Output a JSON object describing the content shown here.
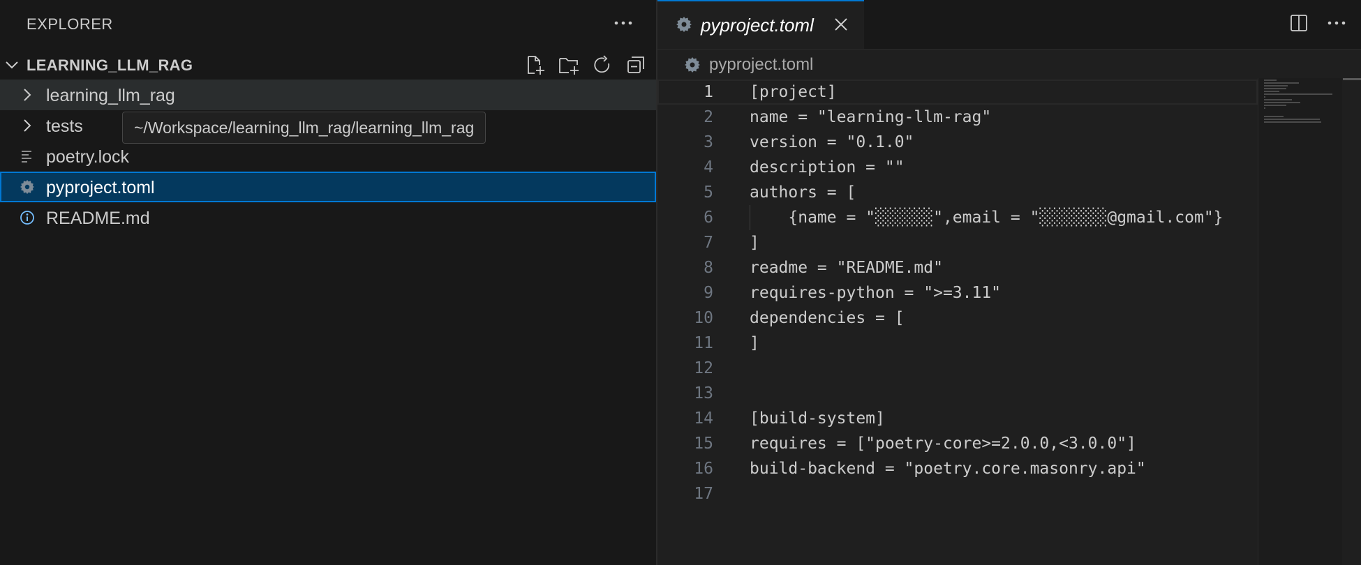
{
  "explorer": {
    "title": "EXPLORER",
    "more_icon": "ellipsis-icon",
    "folder_name": "LEARNING_LLM_RAG",
    "folder_actions": [
      "new-file-icon",
      "new-folder-icon",
      "refresh-icon",
      "collapse-all-icon"
    ],
    "items": [
      {
        "label": "learning_llm_rag",
        "icon": "chevron-right-icon",
        "state": "hover"
      },
      {
        "label": "tests",
        "icon": "chevron-right-icon",
        "state": ""
      },
      {
        "label": "poetry.lock",
        "icon": "lines-file-icon",
        "state": ""
      },
      {
        "label": "pyproject.toml",
        "icon": "gear-icon",
        "state": "selected"
      },
      {
        "label": "README.md",
        "icon": "info-icon",
        "state": ""
      }
    ],
    "tooltip": "~/Workspace/learning_llm_rag/learning_llm_rag"
  },
  "editor": {
    "tab": {
      "label": "pyproject.toml",
      "icon": "gear-icon",
      "close_icon": "close-icon"
    },
    "tab_actions": [
      "split-editor-icon",
      "ellipsis-icon"
    ],
    "breadcrumb": {
      "label": "pyproject.toml",
      "icon": "gear-icon"
    },
    "current_line": 1,
    "lines": [
      "[project]",
      "name = \"learning-llm-rag\"",
      "version = \"0.1.0\"",
      "description = \"\"",
      "authors = [",
      "    {name = \"░░░░░░\",email = \"░░░░░░░@gmail.com\"}",
      "]",
      "readme = \"README.md\"",
      "requires-python = \">=3.11\"",
      "dependencies = [",
      "]",
      "",
      "",
      "[build-system]",
      "requires = [\"poetry-core>=2.0.0,<3.0.0\"]",
      "build-backend = \"poetry.core.masonry.api\"",
      ""
    ]
  },
  "colors": {
    "accent": "#0078d4",
    "selection": "#04395e",
    "hover": "#2a2d2e",
    "gear_icon": "#7f8c98",
    "info_icon": "#75beff"
  }
}
